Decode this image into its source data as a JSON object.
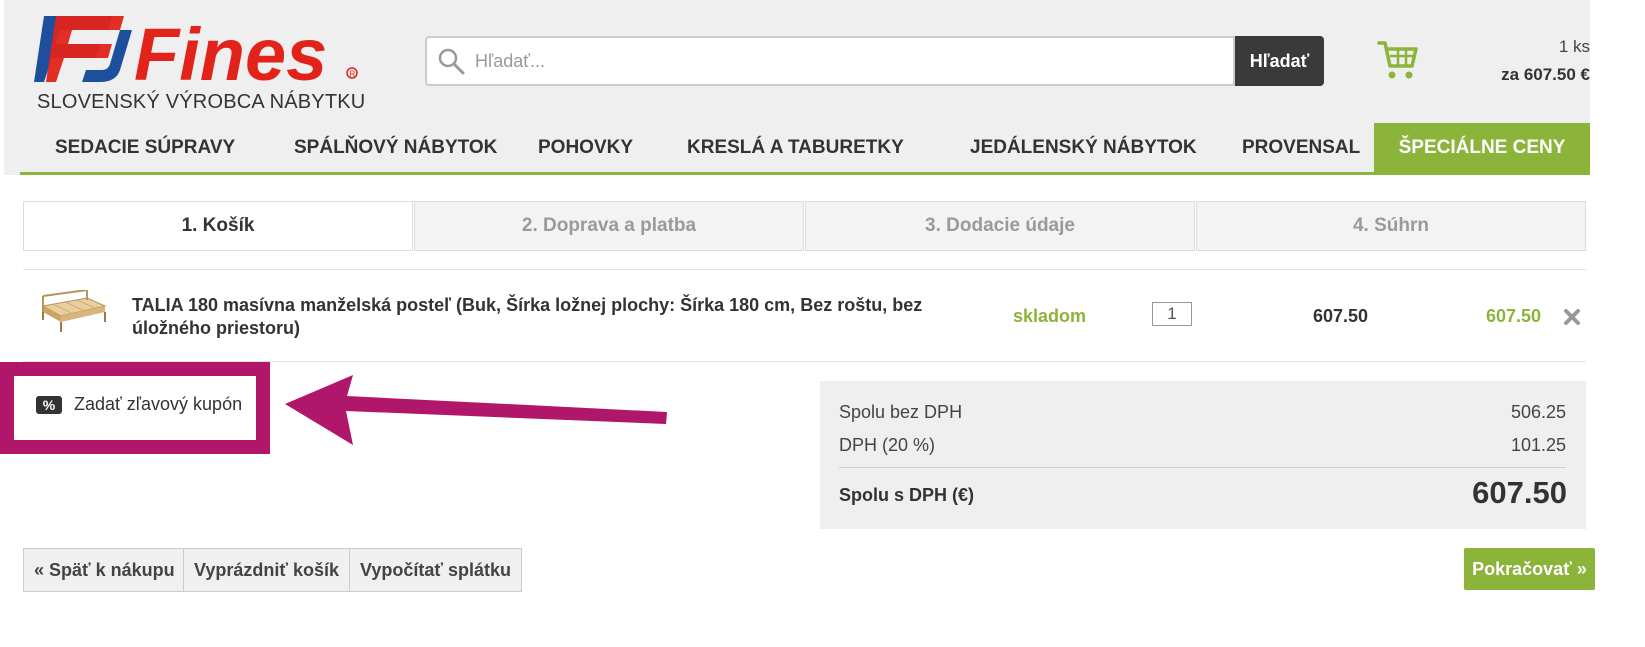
{
  "header": {
    "logo_text": "Fines",
    "slogan": "SLOVENSKÝ VÝROBCA NÁBYTKU",
    "search_placeholder": "Hľadať...",
    "search_button": "Hľadať",
    "cart_count": "1 ks",
    "cart_total": "za 607.50 €"
  },
  "nav": {
    "items": [
      {
        "label": "SEDACIE SÚPRAVY"
      },
      {
        "label": "SPÁLŇOVÝ NÁBYTOK"
      },
      {
        "label": "POHOVKY"
      },
      {
        "label": "KRESLÁ A TABURETKY"
      },
      {
        "label": "JEDÁLENSKÝ NÁBYTOK"
      },
      {
        "label": "PROVENSAL"
      },
      {
        "label": "ŠPECIÁLNE CENY"
      }
    ]
  },
  "steps": [
    {
      "label": "1.  Košík",
      "active": true
    },
    {
      "label": "2.  Doprava a platba",
      "active": false
    },
    {
      "label": "3.  Dodacie údaje",
      "active": false
    },
    {
      "label": "4.  Súhrn",
      "active": false
    }
  ],
  "cart_item": {
    "name": "TALIA 180 masívna manželská posteľ (Buk, Šírka ložnej plochy: Šírka 180 cm, Bez roštu, bez úložného priestoru)",
    "availability": "skladom",
    "quantity": "1",
    "unit_price": "607.50",
    "total_price": "607.50",
    "thumbnail_icon": "bed-image"
  },
  "coupon": {
    "label": "Zadať zľavový kupón",
    "icon": "percent-icon"
  },
  "summary": {
    "without_vat_label": "Spolu bez DPH",
    "without_vat_value": "506.25",
    "vat_label": "DPH (20 %)",
    "vat_value": "101.25",
    "total_label": "Spolu s DPH (€)",
    "total_value": "607.50"
  },
  "buttons": {
    "back": "« Späť k nákupu",
    "empty": "Vyprázdniť košík",
    "installment": "Vypočítať splátku",
    "continue": "Pokračovať »"
  },
  "colors": {
    "accent_green": "#8cb33a",
    "highlight_magenta": "#b0176a",
    "logo_red": "#e2231a",
    "logo_blue": "#1d4f9c"
  }
}
